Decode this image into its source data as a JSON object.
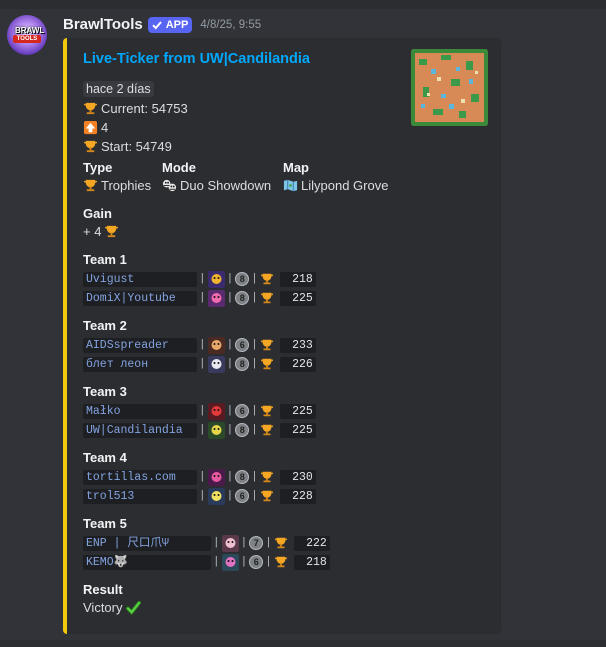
{
  "message": {
    "username": "BrawlTools",
    "badge": "APP",
    "timestamp": "4/8/25, 9:55",
    "avatar_logo_top": "BRAWL",
    "avatar_logo_bottom": "TOOLS"
  },
  "embed": {
    "accent_color": "#f0c80f",
    "title": "Live-Ticker from UW|Candilandia",
    "thumbnail": "map-thumbnail",
    "relative_time": "hace 2 días",
    "current_label": "Current: 54753",
    "change_value": "4",
    "start_label": "Start: 54749",
    "fields": {
      "type": {
        "name": "Type",
        "value": "Trophies"
      },
      "mode": {
        "name": "Mode",
        "value": "Duo Showdown"
      },
      "map": {
        "name": "Map",
        "value": "Lilypond Grove"
      },
      "gain": {
        "name": "Gain",
        "value": "+ 4"
      },
      "result": {
        "name": "Result",
        "value": "Victory"
      }
    },
    "teams": [
      {
        "name": "Team 1",
        "players": [
          {
            "name": "Uvigust",
            "brawler_color": "#3b2a6e",
            "brawler_accent": "#f3b531",
            "level": "8",
            "trophies": "218"
          },
          {
            "name": "DomiX|Youtube",
            "brawler_color": "#5a2a6e",
            "brawler_accent": "#f06ab0",
            "level": "8",
            "trophies": "225"
          }
        ]
      },
      {
        "name": "Team 2",
        "players": [
          {
            "name": "AIDSspreader",
            "brawler_color": "#4a2a22",
            "brawler_accent": "#e9a86a",
            "level": "6",
            "trophies": "233"
          },
          {
            "name": "блет леон",
            "brawler_color": "#3a3a5e",
            "brawler_accent": "#e8e8f0",
            "level": "8",
            "trophies": "226"
          }
        ]
      },
      {
        "name": "Team 3",
        "players": [
          {
            "name": "Małko",
            "brawler_color": "#5a1a22",
            "brawler_accent": "#e23a3a",
            "level": "6",
            "trophies": "225"
          },
          {
            "name": "UW|Candilandia",
            "brawler_color": "#2a4a2a",
            "brawler_accent": "#e6d64a",
            "level": "8",
            "trophies": "225"
          }
        ]
      },
      {
        "name": "Team 4",
        "players": [
          {
            "name": "tortillas.com",
            "brawler_color": "#4a1a4a",
            "brawler_accent": "#e85aa0",
            "level": "8",
            "trophies": "230"
          },
          {
            "name": "trol513",
            "brawler_color": "#2a3a5a",
            "brawler_accent": "#f0e060",
            "level": "6",
            "trophies": "228"
          }
        ]
      },
      {
        "name": "Team 5",
        "players": [
          {
            "name": "ENP | 尺口爪Ψ",
            "brawler_color": "#5a3a4a",
            "brawler_accent": "#f0c0d0",
            "level": "7",
            "trophies": "222"
          },
          {
            "name": "KEMO🐺",
            "brawler_color": "#2a4a5a",
            "brawler_accent": "#e070c0",
            "level": "6",
            "trophies": "218"
          }
        ]
      }
    ]
  },
  "icons": {
    "trophy": "trophy-icon",
    "arrow_up": "arrow-up-icon",
    "duo_showdown": "duo-showdown-icon",
    "map": "map-icon",
    "check": "check-mark-icon"
  }
}
